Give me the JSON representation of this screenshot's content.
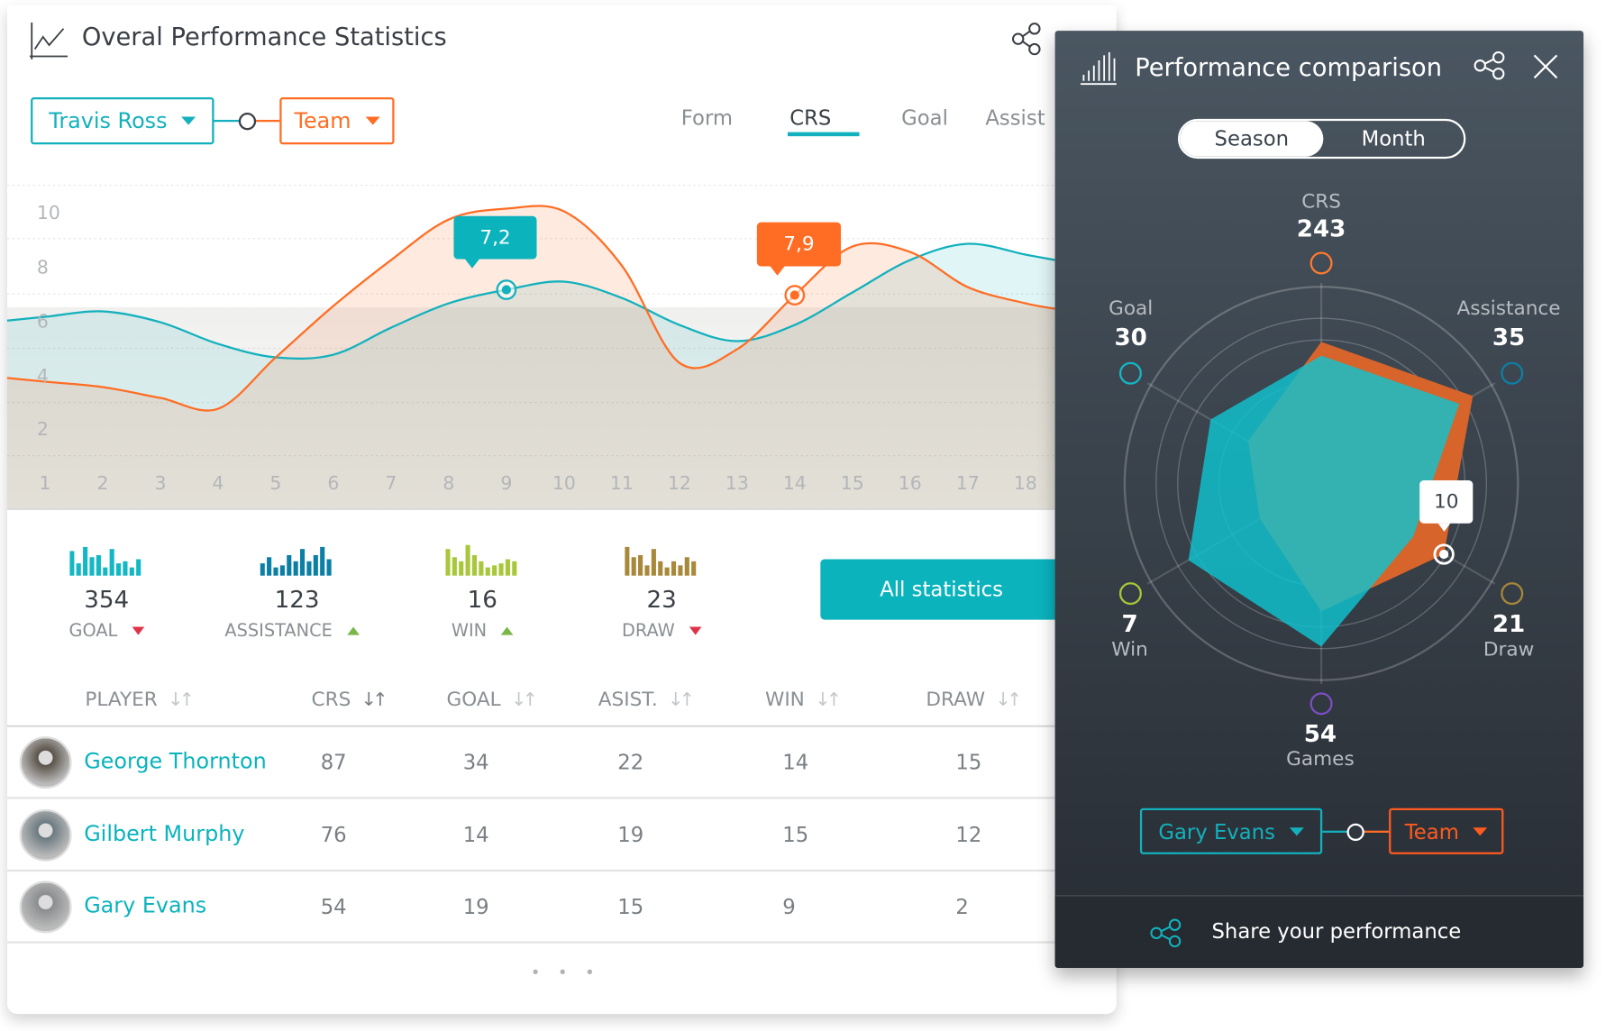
{
  "main": {
    "title": "Overal Performance Statistics",
    "player_select": "Travis Ross",
    "team_select": "Team",
    "tabs": [
      {
        "label": "Form"
      },
      {
        "label": "CRS",
        "active": true
      },
      {
        "label": "Goal"
      },
      {
        "label": "Assist"
      }
    ],
    "all_statistics_label": "All statistics",
    "pagination_dots": "• • •"
  },
  "chart_data": {
    "type": "area",
    "x": [
      1,
      2,
      3,
      4,
      5,
      6,
      7,
      8,
      9,
      10,
      11,
      12,
      13,
      14,
      15,
      16,
      17,
      18
    ],
    "x_tick_labels": [
      "1",
      "2",
      "3",
      "4",
      "5",
      "6",
      "7",
      "8",
      "9",
      "10",
      "11",
      "12",
      "13",
      "14",
      "15",
      "16",
      "17",
      "18"
    ],
    "y_tick_labels": [
      "10",
      "8",
      "6",
      "4",
      "2"
    ],
    "ylim": [
      0,
      10.5
    ],
    "grid": true,
    "series": [
      {
        "color": "#13b1bd",
        "values": [
          6.2,
          6.4,
          6.0,
          5.2,
          4.7,
          4.8,
          5.8,
          6.7,
          7.2,
          7.5,
          6.9,
          5.9,
          5.3,
          5.9,
          7.1,
          8.3,
          8.9,
          8.5
        ]
      },
      {
        "color": "#ff6d24",
        "values": [
          3.8,
          3.6,
          3.2,
          2.8,
          4.7,
          6.6,
          8.3,
          9.8,
          10.2,
          10.1,
          8.1,
          4.5,
          5.0,
          7.0,
          8.8,
          8.6,
          7.3,
          6.7
        ]
      }
    ],
    "annotations": [
      {
        "series": 0,
        "x": 9,
        "label": "7,2"
      },
      {
        "series": 1,
        "x": 14,
        "label": "7,9"
      }
    ]
  },
  "stats": [
    {
      "value": "354",
      "label": "GOAL",
      "trend": "down",
      "color": "#13b8c4"
    },
    {
      "value": "123",
      "label": "ASSISTANCE",
      "trend": "up",
      "color": "#0c7fa6"
    },
    {
      "value": "16",
      "label": "WIN",
      "trend": "up",
      "color": "#a9c73a"
    },
    {
      "value": "23",
      "label": "DRAW",
      "trend": "down",
      "color": "#a8883a"
    }
  ],
  "table": {
    "headers": [
      "PLAYER",
      "CRS",
      "GOAL",
      "ASIST.",
      "WIN",
      "DRAW"
    ],
    "rows": [
      {
        "name": "George Thornton",
        "cells": [
          "87",
          "34",
          "22",
          "14",
          "15"
        ]
      },
      {
        "name": "Gilbert Murphy",
        "cells": [
          "76",
          "14",
          "19",
          "15",
          "12"
        ]
      },
      {
        "name": "Gary Evans",
        "cells": [
          "54",
          "19",
          "15",
          "9",
          "2"
        ]
      }
    ]
  },
  "panel": {
    "title": "Performance comparison",
    "toggle": {
      "options": [
        "Season",
        "Month"
      ],
      "selected": "Season"
    },
    "radar": {
      "axes": [
        {
          "label": "CRS",
          "value": "243",
          "color": "#ff7a2e"
        },
        {
          "label": "Assistance",
          "value": "35",
          "color": "#0c7fa6"
        },
        {
          "label": "Draw",
          "value": "21",
          "color": "#a8883a"
        },
        {
          "label": "Games",
          "value": "54",
          "color": "#7b4fc0"
        },
        {
          "label": "Win",
          "value": "7",
          "color": "#a9c73a"
        },
        {
          "label": "Goal",
          "value": "30",
          "color": "#13b8c4"
        }
      ],
      "team_levels": [
        0.72,
        0.89,
        0.72,
        0.65,
        0.36,
        0.43
      ],
      "player_levels": [
        0.65,
        0.81,
        0.54,
        0.83,
        0.78,
        0.65
      ],
      "tooltip": "10"
    },
    "player_select": "Gary Evans",
    "team_select": "Team",
    "share_label": "Share your performance"
  },
  "colors": {
    "teal": "#13b1bd",
    "orange": "#ff6d24",
    "dark_panel": "#3a434c"
  }
}
